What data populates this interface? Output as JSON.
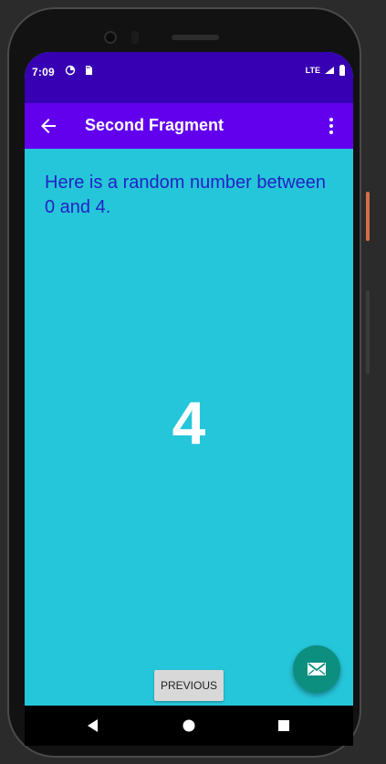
{
  "status": {
    "time": "7:09",
    "network": "LTE"
  },
  "app_bar": {
    "title": "Second Fragment"
  },
  "main": {
    "message": "Here is a random number between 0 and 4.",
    "random_number": "4",
    "previous_label": "PREVIOUS"
  },
  "icons": {
    "back": "arrow-left-icon",
    "overflow": "more-vertical-icon",
    "mail": "mail-icon",
    "nav_back": "triangle-back-icon",
    "nav_home": "circle-home-icon",
    "nav_recent": "square-recent-icon"
  },
  "colors": {
    "status_bar": "#3700b3",
    "app_bar": "#6200ee",
    "content_bg": "#26c6da",
    "message_text": "#2222c4",
    "fab": "#0c8f7f"
  }
}
